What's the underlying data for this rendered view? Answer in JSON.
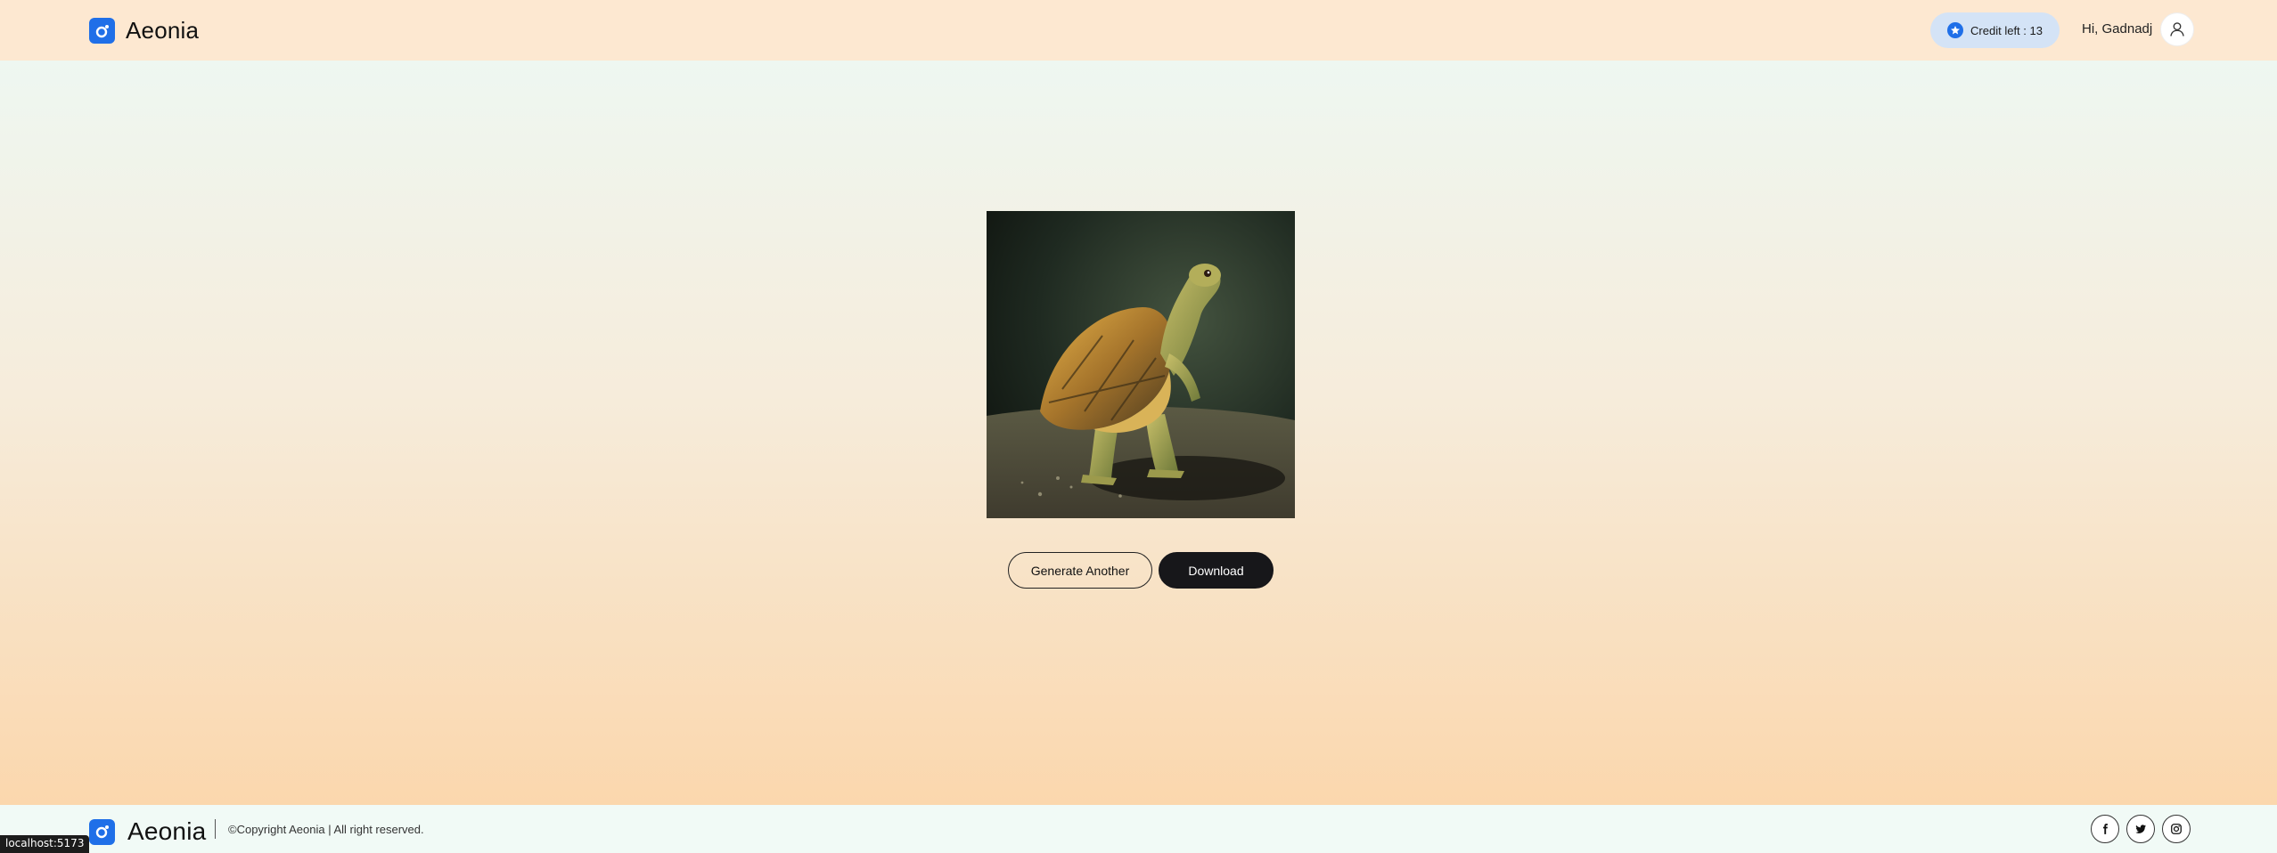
{
  "header": {
    "brand": "Aeonia",
    "credit_label": "Credit left : 13",
    "greeting": "Hi, Gadnadj"
  },
  "main": {
    "image_alt": "Cartoon turtle standing on its hind legs",
    "buttons": {
      "generate_another": "Generate Another",
      "download": "Download"
    }
  },
  "footer": {
    "brand": "Aeonia",
    "copyright": "©Copyright Aeonia | All right reserved.",
    "social_icons": [
      "facebook-icon",
      "twitter-icon",
      "instagram-icon"
    ]
  },
  "status_bar": {
    "url": "localhost:5173"
  },
  "colors": {
    "brand_blue": "#1f6fe8",
    "header_bg": "#fde8d1",
    "credit_pill_bg": "#d4e3f6",
    "primary_button": "#17171a"
  }
}
